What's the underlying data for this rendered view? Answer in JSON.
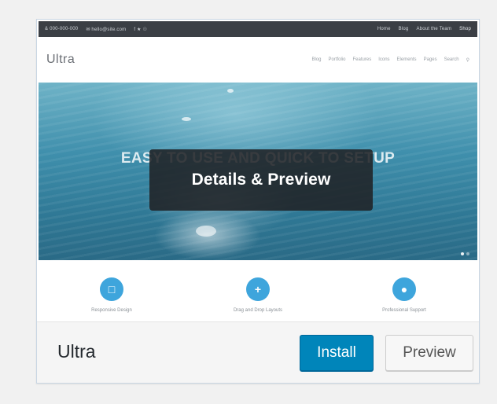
{
  "screenshot": {
    "topbar": {
      "phone": "& 000-000-000",
      "email": "✉ hello@site.com",
      "social": "f ★ ☉",
      "right_links": [
        "Home",
        "Blog",
        "About the Team",
        "Shop"
      ]
    },
    "logo": "Ultra",
    "nav": [
      "Blog",
      "Portfolio",
      "Features",
      "Icons",
      "Elements",
      "Pages",
      "Search",
      "⚲"
    ],
    "hero_headline": "EASY TO USE AND QUICK TO SETUP",
    "features": [
      {
        "icon": "□",
        "label": "Responsive Design"
      },
      {
        "icon": "+",
        "label": "Drag and Drop Layouts"
      },
      {
        "icon": "●",
        "label": "Professional Support"
      }
    ]
  },
  "overlay_label": "Details & Preview",
  "theme_name": "Ultra",
  "buttons": {
    "install": "Install",
    "preview": "Preview"
  },
  "colors": {
    "install_bg": "#0085ba",
    "feature_icon": "#3ea5dc",
    "overlay_bg": "#202226"
  }
}
